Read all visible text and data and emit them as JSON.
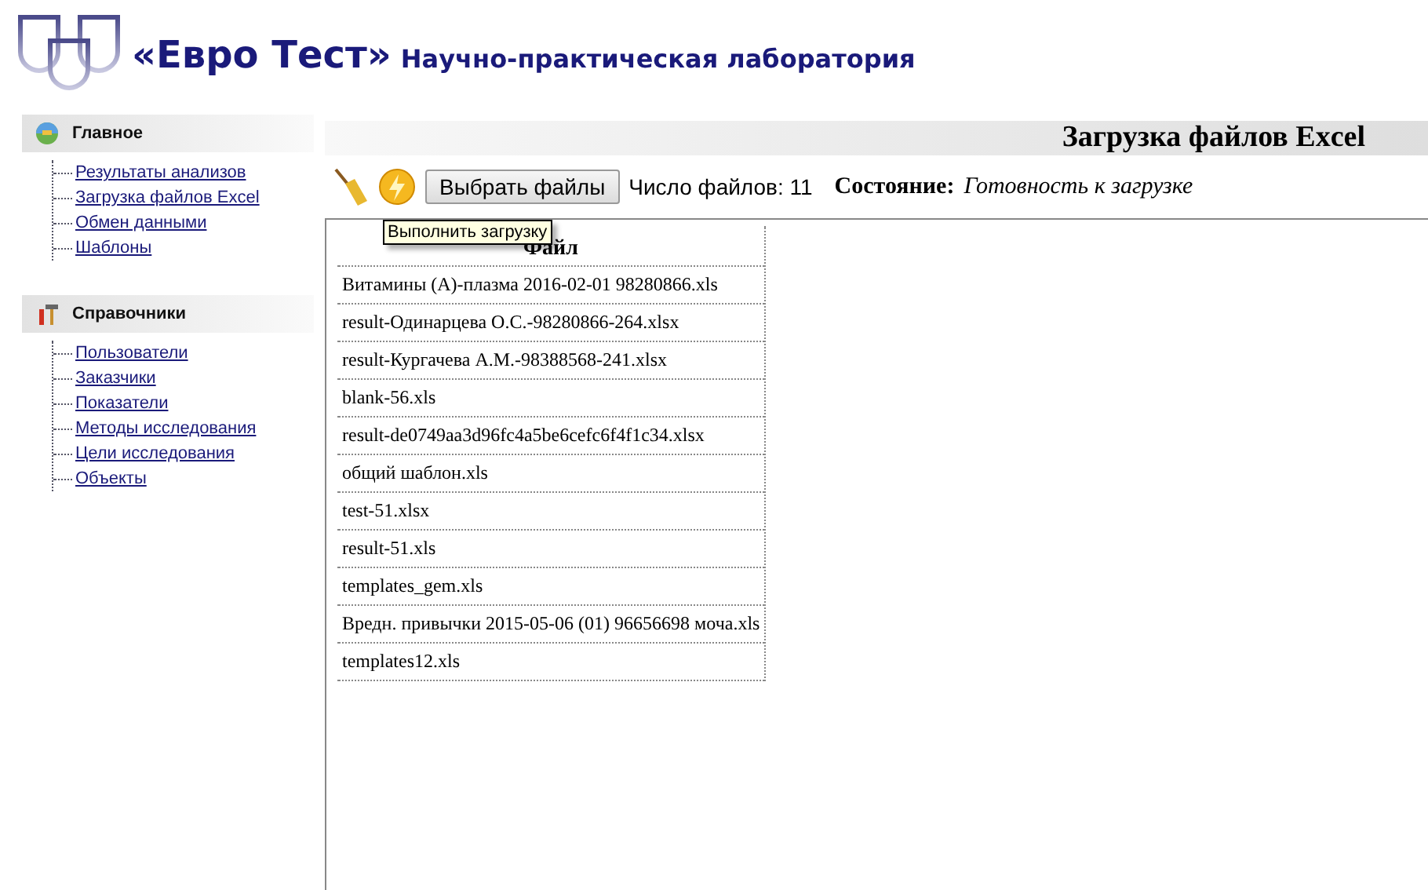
{
  "header": {
    "brand": "«Евро Тест»",
    "subtitle": "Научно-практическая лаборатория"
  },
  "sidebar": {
    "sections": [
      {
        "title": "Главное",
        "kind": "globe",
        "items": [
          "Результаты анализов",
          "Загрузка файлов Excel",
          "Обмен данными",
          "Шаблоны"
        ]
      },
      {
        "title": "Справочники",
        "kind": "tools",
        "items": [
          "Пользователи",
          "Заказчики",
          "Показатели",
          "Методы исследования",
          "Цели исследования",
          "Объекты"
        ]
      }
    ]
  },
  "page_title": "Загрузка файлов Excel",
  "toolbar": {
    "choose_button": "Выбрать файлы",
    "count_label": "Число файлов: 11",
    "state_label": "Состояние:",
    "state_value": "Готовность к загрузке"
  },
  "tooltip": "Выполнить загрузку",
  "table": {
    "columns": [
      "Файл"
    ],
    "rows": [
      "Витамины (А)-плазма 2016-02-01 98280866.xls",
      "result-Одинарцева О.С.-98280866-264.xlsx",
      "result-Кургачева А.М.-98388568-241.xlsx",
      "blank-56.xls",
      "result-de0749aa3d96fc4a5be6cefc6f4f1c34.xlsx",
      "общий шаблон.xls",
      "test-51.xlsx",
      "result-51.xls",
      "templates_gem.xls",
      "Вредн. привычки 2015-05-06 (01) 96656698 моча.xls",
      "templates12.xls"
    ]
  }
}
